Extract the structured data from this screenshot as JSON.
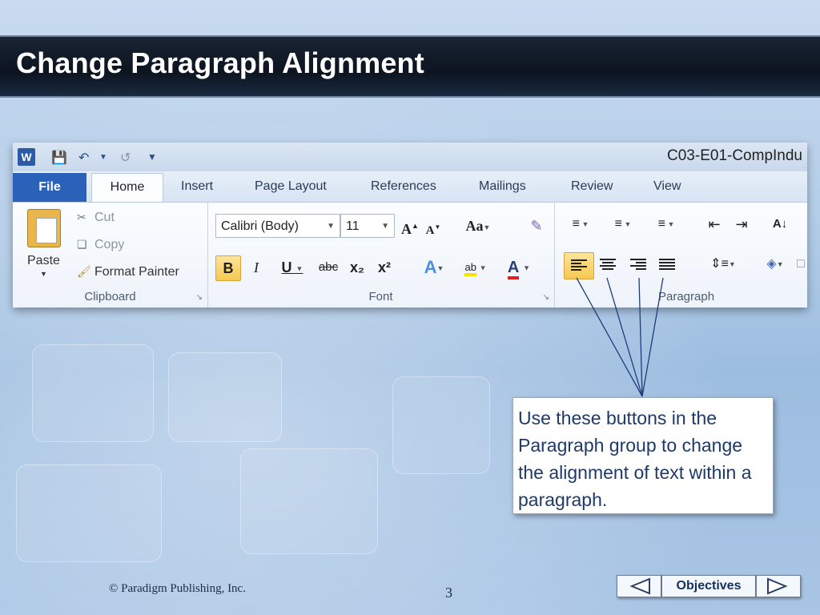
{
  "slide": {
    "title": "Change Paragraph Alignment",
    "footer": "© Paradigm Publishing, Inc.",
    "page_number": "3",
    "nav": {
      "objectives_label": "Objectives"
    }
  },
  "ribbon": {
    "app_icon": "W",
    "document_title": "C03-E01-CompIndu",
    "tabs": [
      "File",
      "Home",
      "Insert",
      "Page Layout",
      "References",
      "Mailings",
      "Review",
      "View"
    ],
    "active_tab": "Home",
    "clipboard": {
      "paste_label": "Paste",
      "cut_label": "Cut",
      "copy_label": "Copy",
      "format_painter_label": "Format Painter",
      "group_label": "Clipboard"
    },
    "font": {
      "font_name": "Calibri (Body)",
      "font_size": "11",
      "change_case": "Aa",
      "bold": "B",
      "italic": "I",
      "underline": "U",
      "strikethrough": "abc",
      "subscript": "x₂",
      "superscript": "x²",
      "highlight": "ab",
      "font_color": "A",
      "group_label": "Font"
    },
    "paragraph": {
      "group_label": "Paragraph",
      "sort_label": "A↓"
    }
  },
  "callout": {
    "text": "Use these buttons in the Paragraph group to change the alignment of text within a paragraph."
  },
  "colors": {
    "file_tab": "#2b62b9",
    "highlight_button": "#f6c850",
    "callout_text": "#1e3a6a",
    "title_bar": "#0c1420"
  }
}
